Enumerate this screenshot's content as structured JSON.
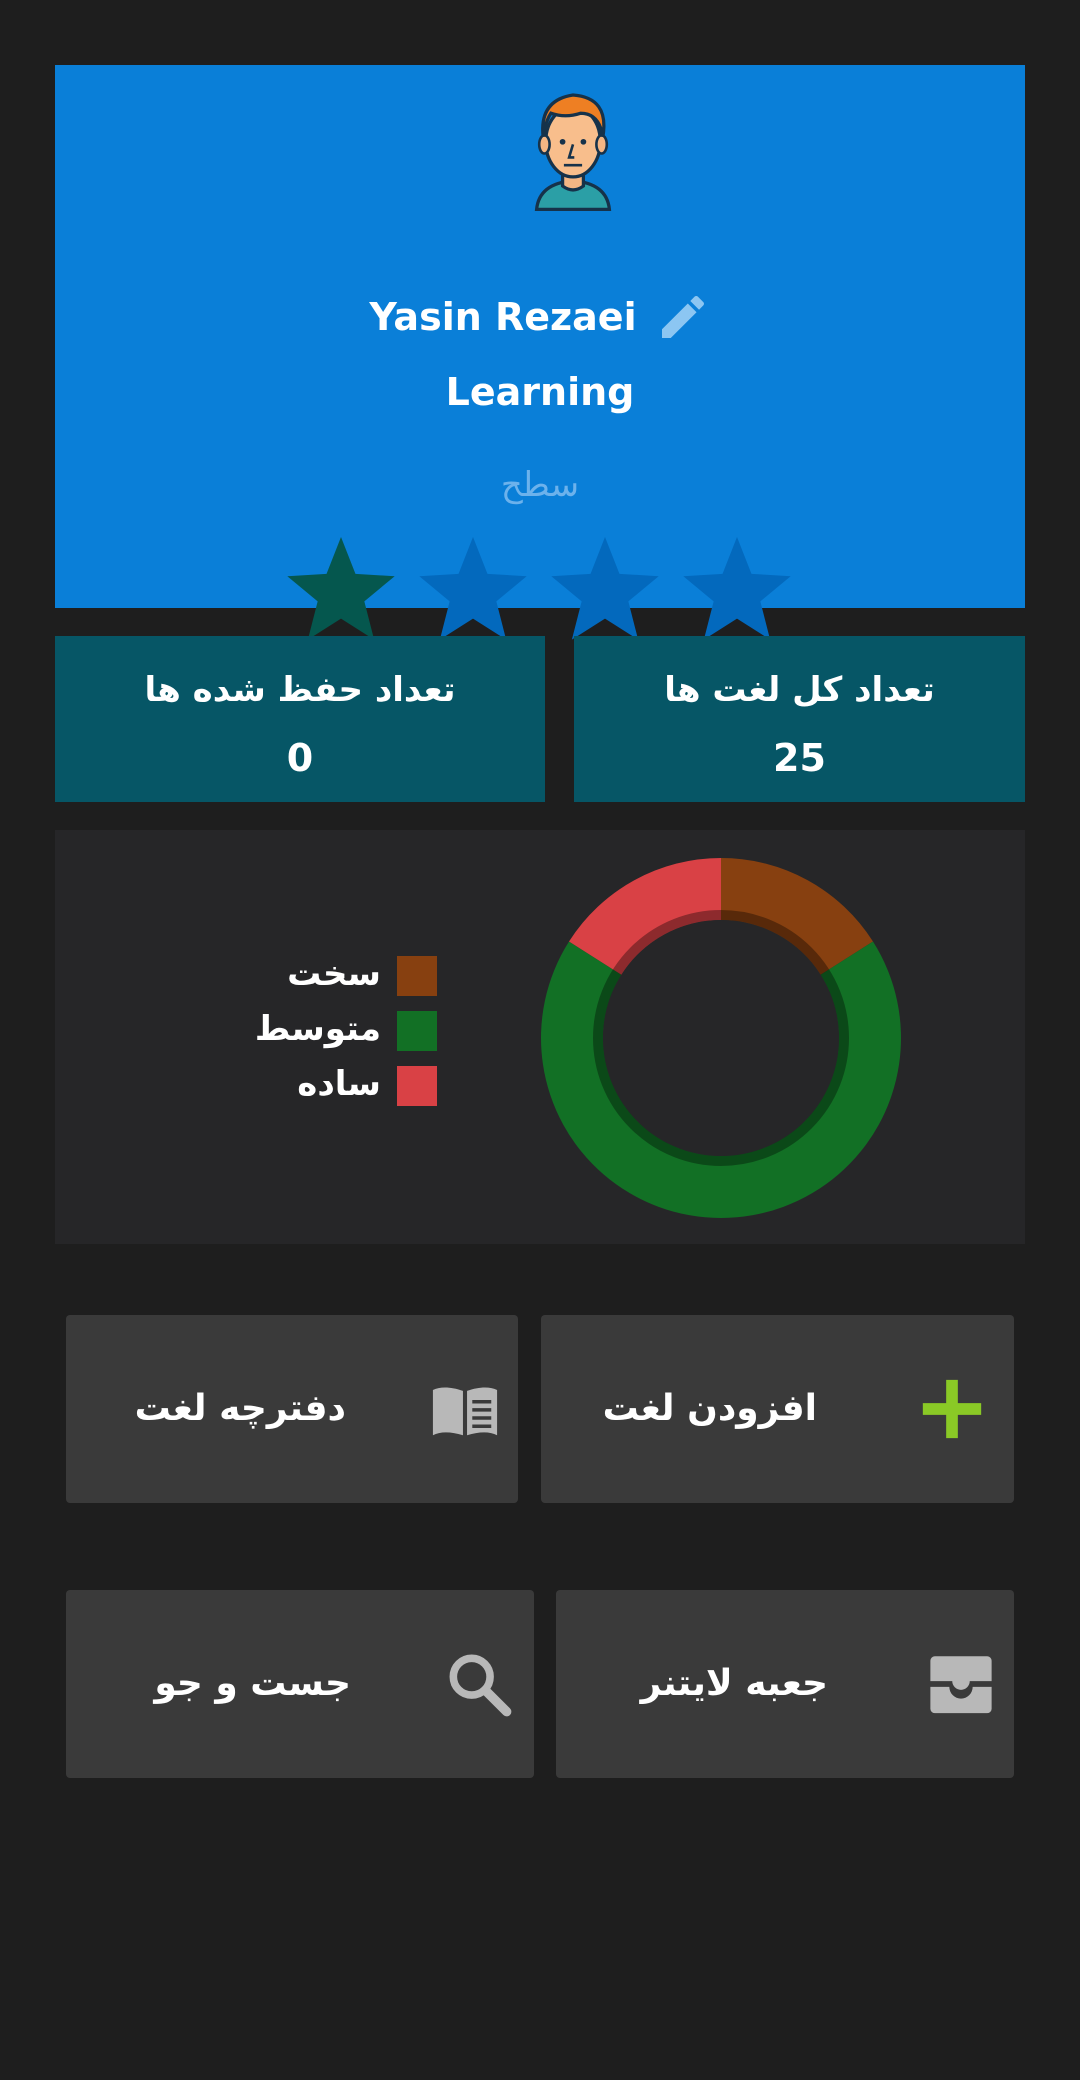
{
  "profile": {
    "name": "Yasin Rezaei",
    "role": "Learning",
    "level_label": "سطح",
    "level_stars": 1,
    "level_max": 4,
    "avatar_icon": "user-avatar-icon",
    "edit_icon": "pencil-icon"
  },
  "stats": {
    "memorized_label": "تعداد حفظ شده ها",
    "memorized_value": "0",
    "total_label": "تعداد کل لغت ها",
    "total_value": "25"
  },
  "chart_data": {
    "type": "pie",
    "style": "donut",
    "categories": [
      "سخت",
      "متوسط",
      "ساده"
    ],
    "values": [
      4,
      17,
      4
    ],
    "colors": [
      "#874010",
      "#127025",
      "#d94145"
    ],
    "legend_position": "left"
  },
  "actions": {
    "add_word": "افزودن لغت",
    "notebook": "دفترچه لغت",
    "leitner_box": "جعبه لایتنر",
    "search": "جست و جو",
    "icons": [
      "plus-icon",
      "book-icon",
      "inbox-icon",
      "search-icon"
    ]
  },
  "colors": {
    "background": "#1e1e1e",
    "profile_card": "#0a7fd8",
    "stat_card": "#065666",
    "star_active": "#05574e",
    "star_inactive": "#0369bd",
    "tile": "#3a3a3a",
    "plus_green": "#8ac926"
  }
}
